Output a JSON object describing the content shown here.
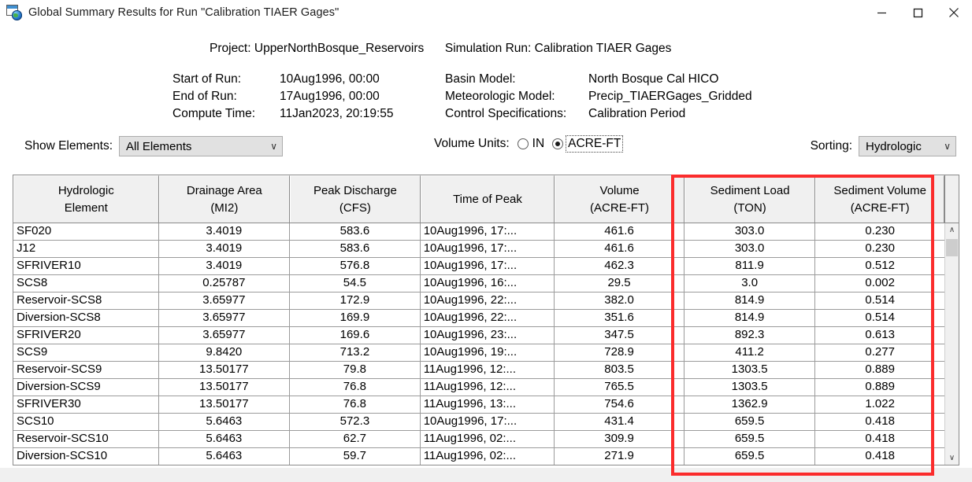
{
  "window": {
    "title": "Global Summary Results for Run \"Calibration TIAER Gages\"",
    "icon": "table-globe-icon",
    "minimize": "—",
    "maximize": "□",
    "close": "✕"
  },
  "header": {
    "project_label": "Project:",
    "project_value": "UpperNorthBosque_Reservoirs",
    "simulation_label": "Simulation Run:",
    "simulation_value": "Calibration TIAER Gages",
    "rows": [
      {
        "label": "Start of Run:",
        "value": "10Aug1996, 00:00",
        "label2": "Basin Model:",
        "value2": "North Bosque Cal HICO"
      },
      {
        "label": "End of Run:",
        "value": "17Aug1996, 00:00",
        "label2": "Meteorologic Model:",
        "value2": "Precip_TIAERGages_Gridded"
      },
      {
        "label": "Compute Time:",
        "value": "11Jan2023, 20:19:55",
        "label2": "Control Specifications:",
        "value2": "Calibration Period"
      }
    ]
  },
  "controls": {
    "show_elements_label": "Show Elements:",
    "show_elements_value": "All Elements",
    "volume_units_label": "Volume Units:",
    "volume_unit_in": "IN",
    "volume_unit_acreft": "ACRE-FT",
    "volume_unit_selected": "ACRE-FT",
    "sorting_label": "Sorting:",
    "sorting_value": "Hydrologic",
    "caret": "∨"
  },
  "table": {
    "columns": [
      {
        "line1": "Hydrologic",
        "line2": "Element"
      },
      {
        "line1": "Drainage Area",
        "line2": "(MI2)"
      },
      {
        "line1": "Peak Discharge",
        "line2": "(CFS)"
      },
      {
        "line1": "Time of Peak",
        "line2": ""
      },
      {
        "line1": "Volume",
        "line2": "(ACRE-FT)"
      },
      {
        "line1": "Sediment Load",
        "line2": "(TON)"
      },
      {
        "line1": "Sediment Volume",
        "line2": "(ACRE-FT)"
      }
    ],
    "rows": [
      [
        "SF020",
        "3.4019",
        "583.6",
        "10Aug1996, 17:...",
        "461.6",
        "303.0",
        "0.230"
      ],
      [
        "J12",
        "3.4019",
        "583.6",
        "10Aug1996, 17:...",
        "461.6",
        "303.0",
        "0.230"
      ],
      [
        "SFRIVER10",
        "3.4019",
        "576.8",
        "10Aug1996, 17:...",
        "462.3",
        "811.9",
        "0.512"
      ],
      [
        "SCS8",
        "0.25787",
        "54.5",
        "10Aug1996, 16:...",
        "29.5",
        "3.0",
        "0.002"
      ],
      [
        "Reservoir-SCS8",
        "3.65977",
        "172.9",
        "10Aug1996, 22:...",
        "382.0",
        "814.9",
        "0.514"
      ],
      [
        "Diversion-SCS8",
        "3.65977",
        "169.9",
        "10Aug1996, 22:...",
        "351.6",
        "814.9",
        "0.514"
      ],
      [
        "SFRIVER20",
        "3.65977",
        "169.6",
        "10Aug1996, 23:...",
        "347.5",
        "892.3",
        "0.613"
      ],
      [
        "SCS9",
        "9.8420",
        "713.2",
        "10Aug1996, 19:...",
        "728.9",
        "411.2",
        "0.277"
      ],
      [
        "Reservoir-SCS9",
        "13.50177",
        "79.8",
        "11Aug1996, 12:...",
        "803.5",
        "1303.5",
        "0.889"
      ],
      [
        "Diversion-SCS9",
        "13.50177",
        "76.8",
        "11Aug1996, 12:...",
        "765.5",
        "1303.5",
        "0.889"
      ],
      [
        "SFRIVER30",
        "13.50177",
        "76.8",
        "11Aug1996, 13:...",
        "754.6",
        "1362.9",
        "1.022"
      ],
      [
        "SCS10",
        "5.6463",
        "572.3",
        "10Aug1996, 17:...",
        "431.4",
        "659.5",
        "0.418"
      ],
      [
        "Reservoir-SCS10",
        "5.6463",
        "62.7",
        "11Aug1996, 02:...",
        "309.9",
        "659.5",
        "0.418"
      ],
      [
        "Diversion-SCS10",
        "5.6463",
        "59.7",
        "11Aug1996, 02:...",
        "271.9",
        "659.5",
        "0.418"
      ]
    ]
  },
  "scrollbar": {
    "up": "∧",
    "down": "∨"
  },
  "annotation": {
    "highlight_color": "#fb2c2c",
    "highlighted_columns": [
      "Sediment Load (TON)",
      "Sediment Volume (ACRE-FT)"
    ]
  }
}
